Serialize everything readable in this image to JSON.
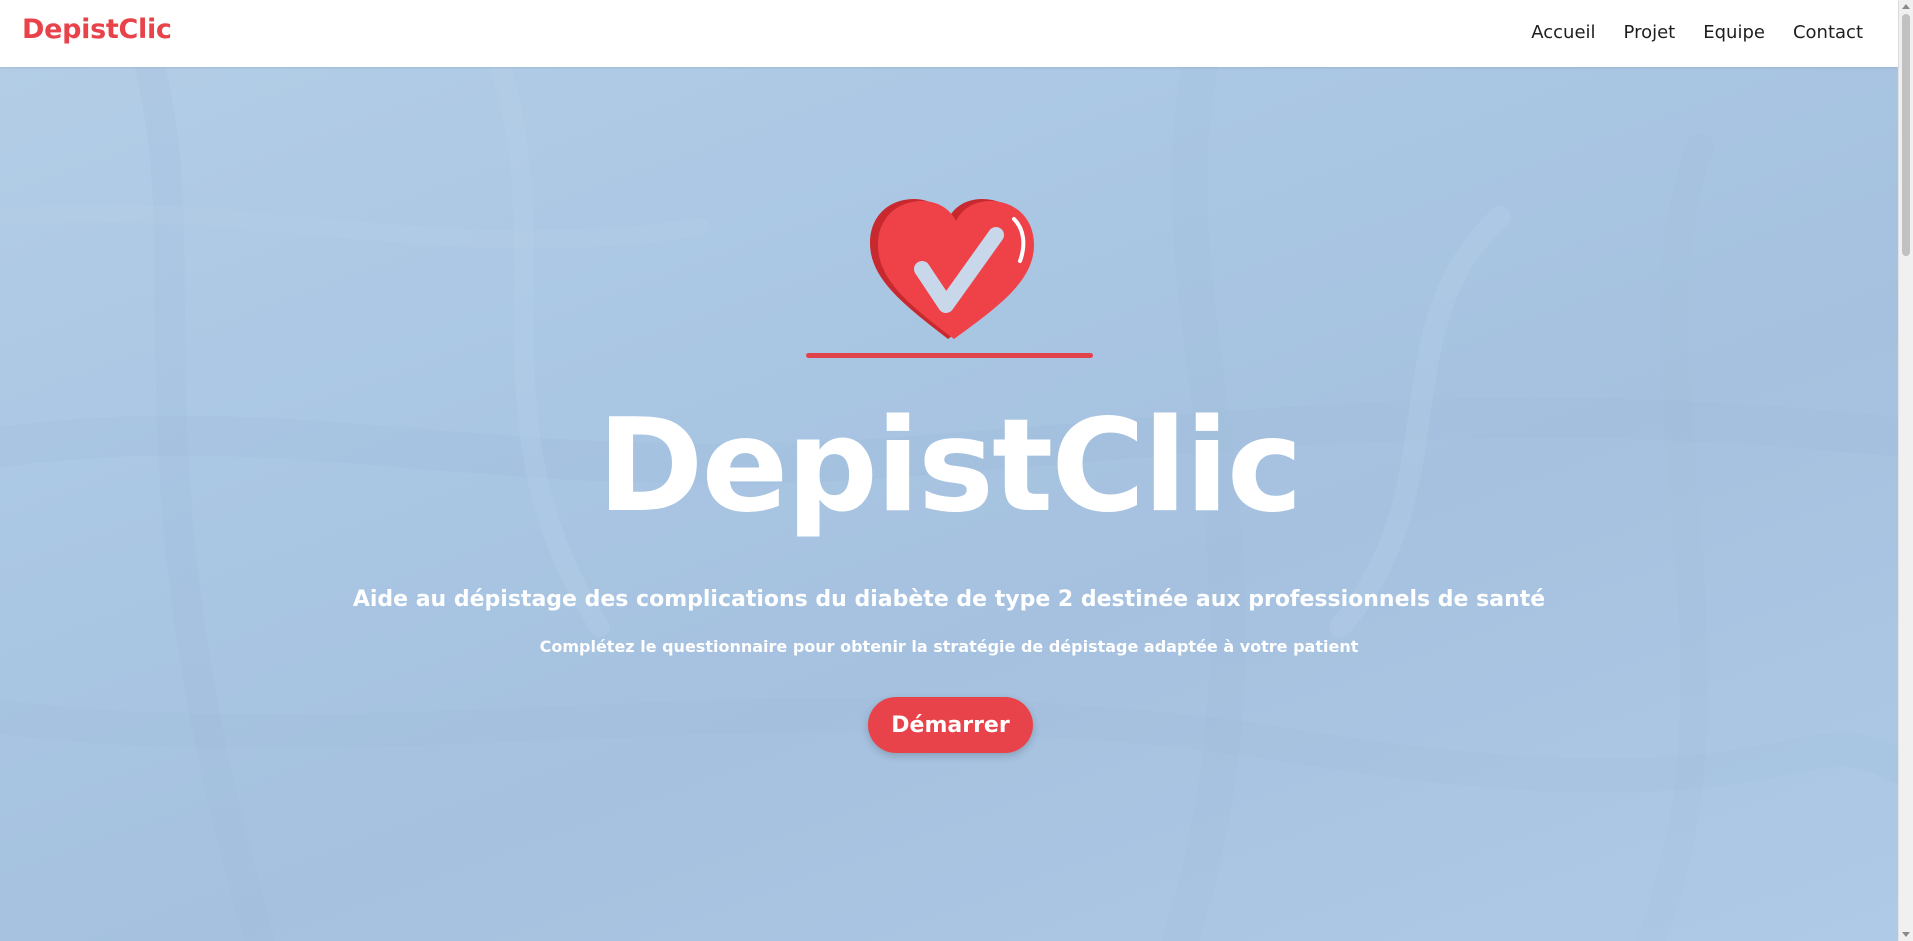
{
  "brand": {
    "name": "DepistClic"
  },
  "nav": {
    "items": [
      {
        "label": "Accueil"
      },
      {
        "label": "Projet"
      },
      {
        "label": "Equipe"
      },
      {
        "label": "Contact"
      }
    ]
  },
  "hero": {
    "title": "DepistClic",
    "subtitle": "Aide au dépistage des complications du diabète de type 2 destinée aux professionnels de santé",
    "instructions": "Complétez le questionnaire pour obtenir la stratégie de dépistage adaptée à votre patient",
    "start_label": "Démarrer",
    "logo_icon": "heart-check-icon"
  },
  "colors": {
    "accent": "#e8434a",
    "hero_background": "#a9c6e3",
    "text_light": "#ffffff",
    "nav_text": "#1e1e1e"
  }
}
